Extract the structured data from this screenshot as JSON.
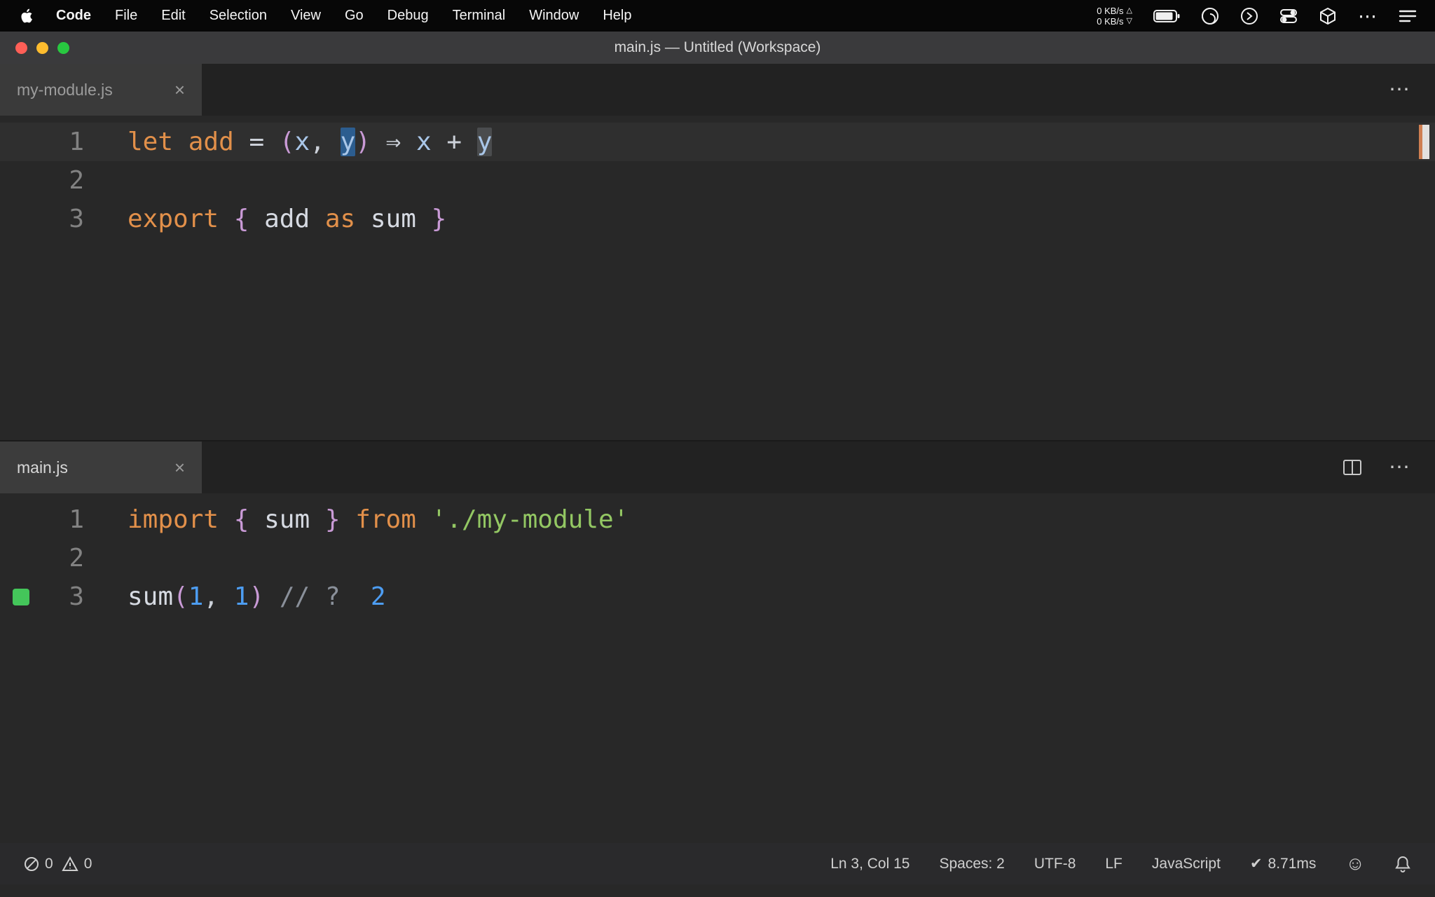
{
  "menubar": {
    "app_menu": "Code",
    "items": [
      "File",
      "Edit",
      "Selection",
      "View",
      "Go",
      "Debug",
      "Terminal",
      "Window",
      "Help"
    ],
    "net_up": "0 KB/s",
    "net_down": "0 KB/s"
  },
  "titlebar": {
    "title": "main.js — Untitled (Workspace)"
  },
  "icons": {
    "close": "×",
    "more": "⋯",
    "up_triangle": "△",
    "down_triangle": "▽",
    "check": "✔",
    "smiley": "☺"
  },
  "editors": {
    "top": {
      "tab": "my-module.js",
      "lines": [
        {
          "num": "1",
          "current": true,
          "ruler": true,
          "tokens": [
            [
              "k",
              "let"
            ],
            [
              "t",
              " "
            ],
            [
              "k",
              "add"
            ],
            [
              "t",
              " "
            ],
            [
              "o",
              "="
            ],
            [
              "t",
              " "
            ],
            [
              "p",
              "("
            ],
            [
              "v",
              "x"
            ],
            [
              "o",
              ","
            ],
            [
              "t",
              " "
            ],
            [
              "vsel",
              "y"
            ],
            [
              "p",
              ")"
            ],
            [
              "t",
              " "
            ],
            [
              "o",
              "⇒"
            ],
            [
              "t",
              " "
            ],
            [
              "v",
              "x"
            ],
            [
              "t",
              " "
            ],
            [
              "o",
              "+"
            ],
            [
              "t",
              " "
            ],
            [
              "vhl",
              "y"
            ]
          ]
        },
        {
          "num": "2",
          "tokens": []
        },
        {
          "num": "3",
          "tokens": [
            [
              "k",
              "export"
            ],
            [
              "t",
              " "
            ],
            [
              "p",
              "{"
            ],
            [
              "t",
              " "
            ],
            [
              "w",
              "add"
            ],
            [
              "t",
              " "
            ],
            [
              "k",
              "as"
            ],
            [
              "t",
              " "
            ],
            [
              "w",
              "sum"
            ],
            [
              "t",
              " "
            ],
            [
              "p",
              "}"
            ]
          ]
        }
      ]
    },
    "bottom": {
      "tab": "main.js",
      "lines": [
        {
          "num": "1",
          "tokens": [
            [
              "k",
              "import"
            ],
            [
              "t",
              " "
            ],
            [
              "p",
              "{"
            ],
            [
              "t",
              " "
            ],
            [
              "w",
              "sum"
            ],
            [
              "t",
              " "
            ],
            [
              "p",
              "}"
            ],
            [
              "t",
              " "
            ],
            [
              "k",
              "from"
            ],
            [
              "t",
              " "
            ],
            [
              "s",
              "'./my-module'"
            ]
          ]
        },
        {
          "num": "2",
          "tokens": []
        },
        {
          "num": "3",
          "marker": true,
          "tokens": [
            [
              "w",
              "sum"
            ],
            [
              "p",
              "("
            ],
            [
              "n",
              "1"
            ],
            [
              "o",
              ","
            ],
            [
              "t",
              " "
            ],
            [
              "n",
              "1"
            ],
            [
              "p",
              ")"
            ],
            [
              "t",
              " "
            ],
            [
              "c",
              "// ?"
            ],
            [
              "t",
              "  "
            ],
            [
              "n",
              "2"
            ]
          ]
        }
      ]
    }
  },
  "statusbar": {
    "errors": "0",
    "warnings": "0",
    "cursor": "Ln 3, Col 15",
    "indent": "Spaces: 2",
    "encoding": "UTF-8",
    "eol": "LF",
    "language": "JavaScript",
    "perf": "8.71ms"
  }
}
